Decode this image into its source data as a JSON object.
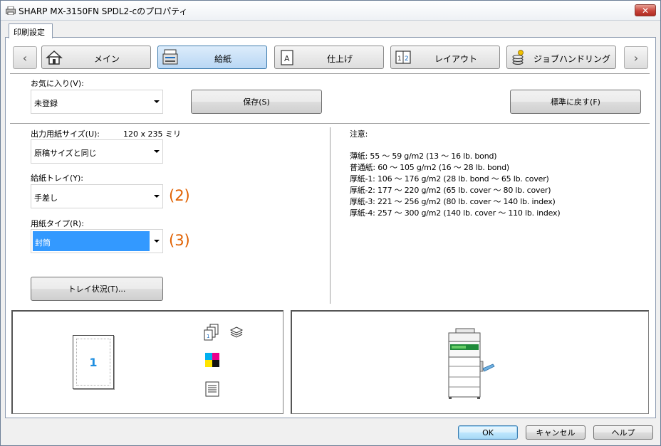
{
  "window": {
    "title": "SHARP MX-3150FN SPDL2-cのプロパティ",
    "close_glyph": "✕"
  },
  "tab": {
    "label": "印刷設定"
  },
  "nav": {
    "prev_glyph": "‹",
    "next_glyph": "›",
    "buttons": [
      {
        "label": "メイン",
        "icon": "home-icon"
      },
      {
        "label": "給紙",
        "icon": "paper-tray-icon"
      },
      {
        "label": "仕上げ",
        "icon": "finishing-icon"
      },
      {
        "label": "レイアウト",
        "icon": "layout-icon"
      },
      {
        "label": "ジョブハンドリング",
        "icon": "job-handling-icon"
      }
    ],
    "active": "給紙"
  },
  "favorites": {
    "label": "お気に入り(V):",
    "value": "未登録",
    "save_label": "保存(S)",
    "reset_label": "標準に戻す(F)"
  },
  "output_size": {
    "label": "出力用紙サイズ(U):",
    "dimension": "120 x 235 ミリ",
    "value": "原稿サイズと同じ"
  },
  "paper_tray": {
    "label": "給紙トレイ(Y):",
    "value": "手差し",
    "marker": "(2)"
  },
  "paper_type": {
    "label": "用紙タイプ(R):",
    "value": "封筒",
    "marker": "(3)"
  },
  "tray_status_label": "トレイ状況(T)...",
  "notes": {
    "heading": "注意:",
    "lines": [
      "薄紙: 55 〜 59 g/m2 (13 〜 16 lb. bond)",
      "普通紙: 60 〜 105 g/m2 (16 〜 28 lb. bond)",
      "厚紙-1: 106 〜 176 g/m2 (28 lb. bond 〜 65 lb. cover)",
      "厚紙-2: 177 〜 220 g/m2 (65 lb. cover 〜 80 lb. cover)",
      "厚紙-3: 221 〜 256 g/m2 (80 lb. cover 〜 140 lb. index)",
      "厚紙-4: 257 〜 300 g/m2 (140 lb. cover 〜 110 lb. index)"
    ]
  },
  "preview": {
    "page_number": "1"
  },
  "footer": {
    "ok": "OK",
    "cancel": "キャンセル",
    "help": "ヘルプ"
  },
  "colors": {
    "accent_selection": "#3399ff",
    "marker": "#e06000",
    "page_number": "#1f8ee0",
    "close_button": "#c7443a"
  }
}
